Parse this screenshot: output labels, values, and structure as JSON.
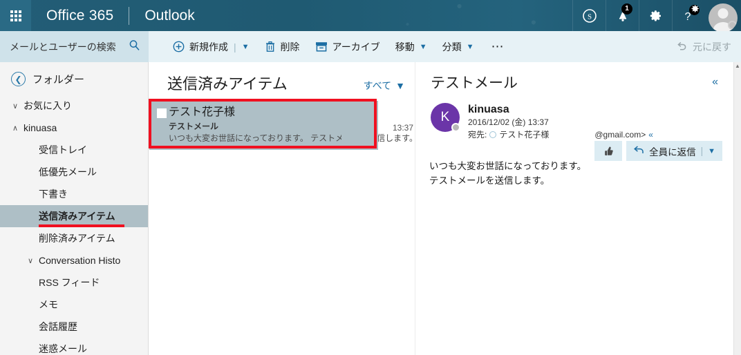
{
  "topbar": {
    "waffle_label": "app-launcher",
    "brand": "Office 365",
    "app_name": "Outlook",
    "icons": [
      {
        "name": "skype-icon",
        "glyph": "S"
      },
      {
        "name": "notifications-bell-icon",
        "glyph": "✉",
        "badge": "1"
      },
      {
        "name": "settings-gear-icon",
        "glyph": "⚙"
      },
      {
        "name": "help-icon",
        "glyph": "?",
        "badge": "✸"
      }
    ],
    "avatar_name": "user-avatar"
  },
  "search": {
    "placeholder": "メールとユーザーの検索",
    "value": "メールとユーザーの検索",
    "icon": "search-icon"
  },
  "toolbar": {
    "new_label": "新規作成",
    "delete_label": "削除",
    "archive_label": "アーカイブ",
    "move_label": "移動",
    "category_label": "分類",
    "more_label": "⋯",
    "undo_label": "元に戻す",
    "accent_color": "#1c6ea4",
    "bg_color": "#e7f2f6"
  },
  "sidebar": {
    "header_label": "フォルダー",
    "back_icon": "back-arrow-icon",
    "items": [
      {
        "label": "お気に入り",
        "level": 1,
        "chevron": "∨",
        "selected": false
      },
      {
        "label": "kinuasa",
        "level": 1,
        "chevron": "∧",
        "selected": false
      },
      {
        "label": "受信トレイ",
        "level": 2,
        "chevron": "",
        "selected": false
      },
      {
        "label": "低優先メール",
        "level": 2,
        "chevron": "",
        "selected": false
      },
      {
        "label": "下書き",
        "level": 2,
        "chevron": "",
        "selected": false
      },
      {
        "label": "送信済みアイテム",
        "level": 2,
        "chevron": "",
        "selected": true
      },
      {
        "label": "削除済みアイテム",
        "level": 2,
        "chevron": "",
        "selected": false
      },
      {
        "label": "Conversation Histo",
        "level": 2,
        "chevron": "∨",
        "selected": false
      },
      {
        "label": "RSS フィード",
        "level": 2,
        "chevron": "",
        "selected": false
      },
      {
        "label": "メモ",
        "level": 2,
        "chevron": "",
        "selected": false
      },
      {
        "label": "会話履歴",
        "level": 2,
        "chevron": "",
        "selected": false
      },
      {
        "label": "迷惑メール",
        "level": 2,
        "chevron": "",
        "selected": false
      }
    ],
    "selected_bg": "#aebfc6",
    "annotation_color": "#f01020"
  },
  "list": {
    "title": "送信済みアイテム",
    "filter_label": "すべて",
    "filter_chevron": "∨",
    "messages": [
      {
        "from": "テスト花子様",
        "subject": "テストメール",
        "preview": "いつも大変お世話になっております。 テストメールを送信します。",
        "time": "13:37",
        "selected": true
      }
    ]
  },
  "reading": {
    "subject": "テストメール",
    "collapse_icon": "«",
    "sender_initial": "K",
    "sender_name": "kinuasa",
    "sender_date": "2016/12/02 (金) 13:37",
    "to_label": "宛先:",
    "to_name": "テスト花子様",
    "to_domain": "@gmail.com>",
    "to_expand_icon": "«",
    "thumb_icon": "☝",
    "reply_all_label": "全員に返信",
    "reply_chevron": "∨",
    "body_lines": [
      "いつも大変お世話になっております。",
      "テストメールを送信します。"
    ],
    "avatar_color": "#6b35a8"
  },
  "scrollbar": {
    "up_arrow": "▲"
  }
}
